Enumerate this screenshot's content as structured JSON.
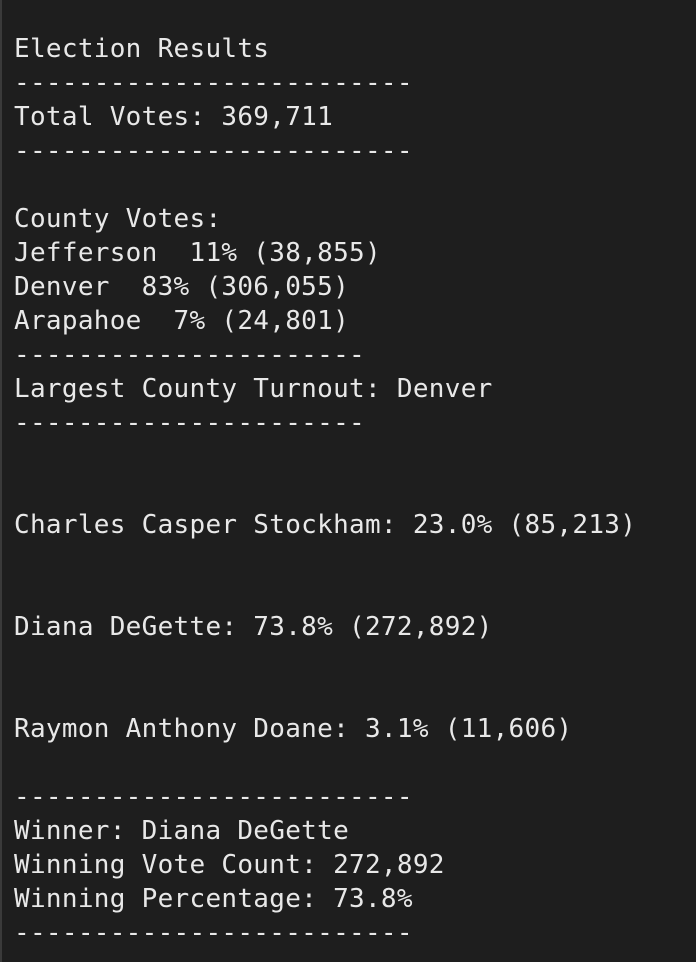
{
  "terminal": {
    "title": "Election Results",
    "divider_long": "-------------------------",
    "divider_short": "----------------------",
    "total_votes": "Total Votes: 369,711",
    "county_header": "County Votes:",
    "counties": [
      "Jefferson  11% (38,855)",
      "Denver  83% (306,055)",
      "Arapahoe  7% (24,801)"
    ],
    "largest_turnout": "Largest County Turnout: Denver",
    "candidates": [
      "Charles Casper Stockham: 23.0% (85,213)",
      "Diana DeGette: 73.8% (272,892)",
      "Raymon Anthony Doane: 3.1% (11,606)"
    ],
    "winner": "Winner: Diana DeGette",
    "winning_vote_count": "Winning Vote Count: 272,892",
    "winning_percentage": "Winning Percentage: 73.8%"
  }
}
